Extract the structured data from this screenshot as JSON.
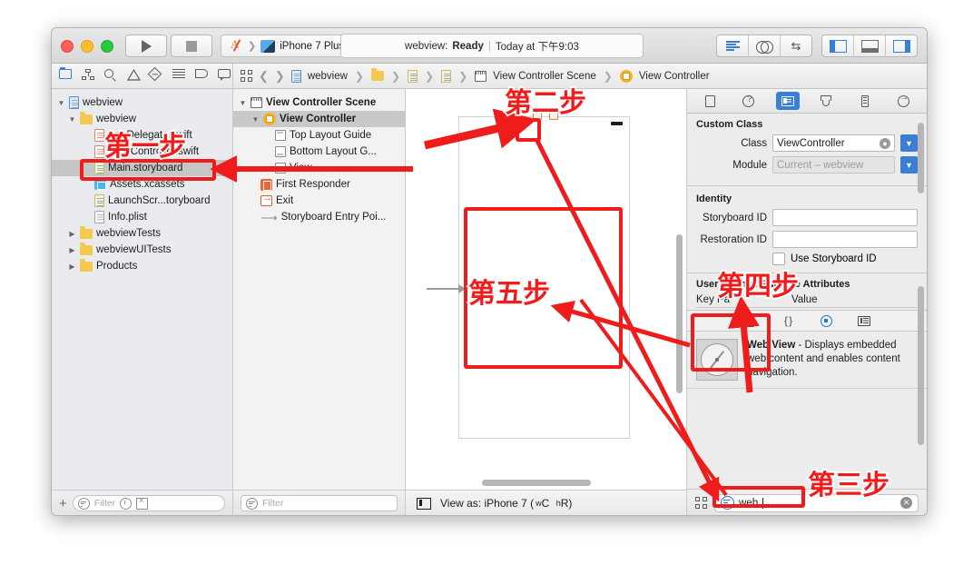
{
  "window": {
    "toolbar": {
      "scheme_app": "",
      "scheme_device": "iPhone 7 Plus",
      "status_project": "webview:",
      "status_state": "Ready",
      "status_time": "Today at 下午9:03"
    },
    "jumpbar": {
      "crumbs": [
        "webview",
        "View Controller Scene",
        "View Controller"
      ]
    }
  },
  "navigator": {
    "items": [
      {
        "label": "webview",
        "level": 0,
        "icon": "project-icon",
        "expanded": true
      },
      {
        "label": "webview",
        "level": 1,
        "icon": "folder-icon",
        "expanded": true
      },
      {
        "label": "AppDelegate.swift",
        "level": 2,
        "icon": "swift-icon"
      },
      {
        "label": "ViewController.swift",
        "level": 2,
        "icon": "swift-icon"
      },
      {
        "label": "Main.storyboard",
        "level": 2,
        "icon": "storyboard-icon",
        "selected": true
      },
      {
        "label": "Assets.xcassets",
        "level": 2,
        "icon": "assets-icon"
      },
      {
        "label": "LaunchScr...toryboard",
        "level": 2,
        "icon": "storyboard-icon"
      },
      {
        "label": "Info.plist",
        "level": 2,
        "icon": "plist-icon"
      },
      {
        "label": "webviewTests",
        "level": 1,
        "icon": "folder-icon",
        "collapsed": true
      },
      {
        "label": "webviewUITests",
        "level": 1,
        "icon": "folder-icon",
        "collapsed": true
      },
      {
        "label": "Products",
        "level": 1,
        "icon": "folder-icon",
        "collapsed": true
      }
    ],
    "filter_placeholder": "Filter"
  },
  "outline": {
    "items": [
      {
        "label": "View Controller Scene",
        "level": 0,
        "icon": "scene-icon",
        "expanded": true
      },
      {
        "label": "View Controller",
        "level": 1,
        "icon": "view-controller-icon",
        "expanded": true,
        "selected": true
      },
      {
        "label": "Top Layout Guide",
        "level": 2,
        "icon": "top-layout-guide-icon"
      },
      {
        "label": "Bottom Layout G...",
        "level": 2,
        "icon": "bottom-layout-guide-icon"
      },
      {
        "label": "View",
        "level": 2,
        "icon": "view-icon"
      },
      {
        "label": "First Responder",
        "level": 1,
        "icon": "first-responder-icon"
      },
      {
        "label": "Exit",
        "level": 1,
        "icon": "exit-icon"
      },
      {
        "label": "Storyboard Entry Poi...",
        "level": 1,
        "icon": "entry-point-arrow-icon"
      }
    ],
    "filter_placeholder": "Filter"
  },
  "canvas": {
    "view_as_label": "View as: iPhone 7 (",
    "view_as_wc": "w",
    "view_as_wc2": "C",
    "view_as_hr": "h",
    "view_as_hr2": "R",
    "view_as_close": ")"
  },
  "inspector": {
    "sections": {
      "custom_class": {
        "title": "Custom Class",
        "class_label": "Class",
        "class_value": "ViewController",
        "module_label": "Module",
        "module_value": "Current – webview"
      },
      "identity": {
        "title": "Identity",
        "storyboard_id_label": "Storyboard ID",
        "storyboard_id_value": "",
        "restoration_id_label": "Restoration ID",
        "restoration_id_value": "",
        "use_storyboard_id_label": "Use Storyboard ID"
      },
      "user_defined": {
        "title": "User Defined Runtime Attributes",
        "col_key": "Key Pa",
        "col_value": "Value"
      }
    },
    "library": {
      "item_title": "Web View",
      "item_desc": " - Displays embedded web content and enables content navigation."
    },
    "search_value": "web"
  },
  "annotations": [
    {
      "id": "step1",
      "text": "第一步"
    },
    {
      "id": "step2",
      "text": "第二步"
    },
    {
      "id": "step3",
      "text": "第三步"
    },
    {
      "id": "step4",
      "text": "第四步"
    },
    {
      "id": "step5",
      "text": "第五步"
    }
  ],
  "colors": {
    "annotation_red": "#ef1c1c",
    "accent_blue": "#3b7fd4",
    "selection_gray": "#c6c6c6"
  }
}
